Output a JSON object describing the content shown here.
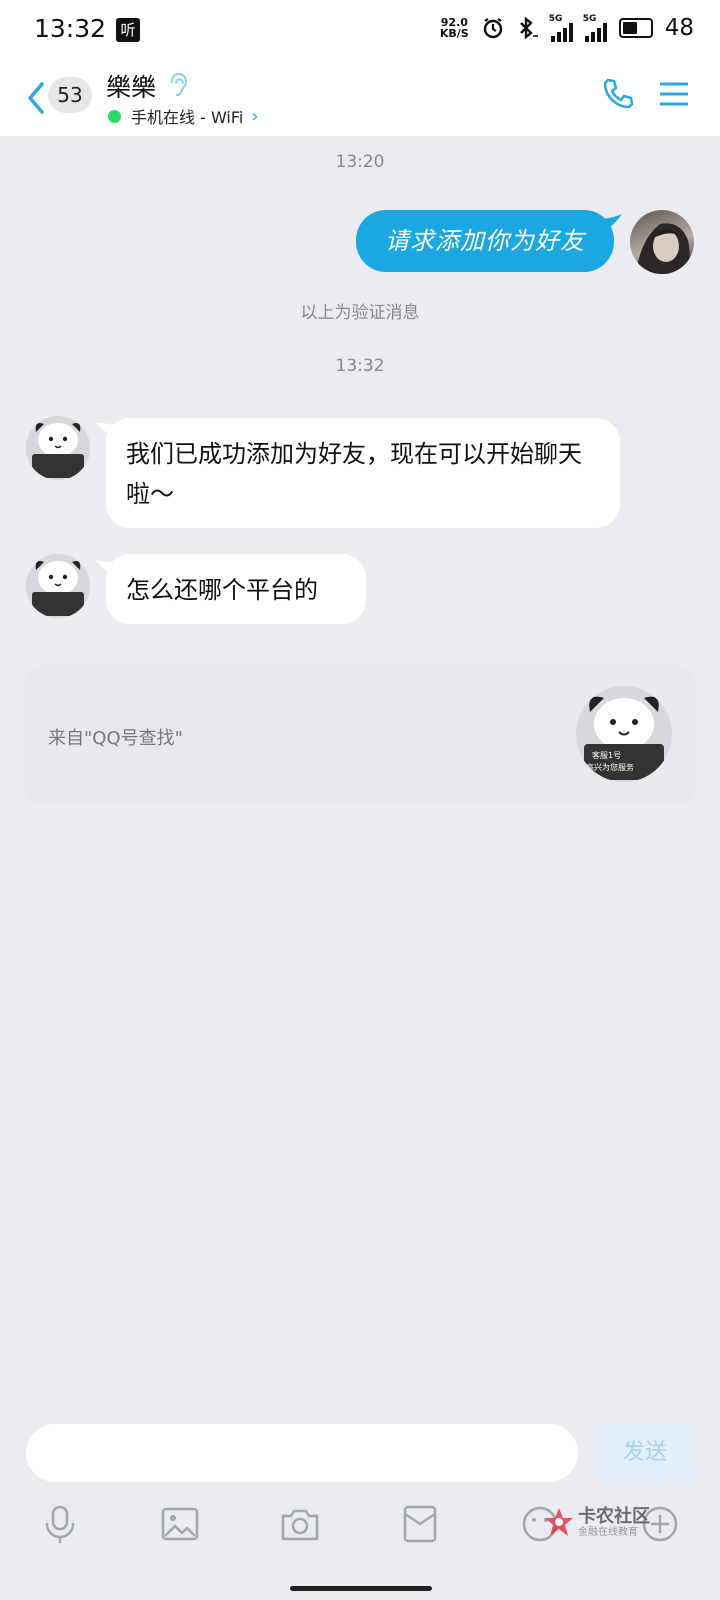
{
  "status_bar": {
    "time": "13:32",
    "app_badge": "听",
    "net_speed_value": "92.0",
    "net_speed_unit": "KB/S",
    "signal_1_label": "5G",
    "signal_2_label": "5G",
    "battery": "48"
  },
  "header": {
    "unread_count": "53",
    "contact_name": "樂樂",
    "presence": "手机在线 - WiFi"
  },
  "chat": {
    "timestamp_1": "13:20",
    "outgoing_message": "请求添加你为好友",
    "verification_note": "以上为验证消息",
    "timestamp_2": "13:32",
    "incoming_message_1": "我们已成功添加为好友，现在可以开始聊天啦～",
    "incoming_message_2": "怎么还哪个平台的",
    "bot_avatar_line1": "客服1号",
    "bot_avatar_line2": "高兴为您服务",
    "source_card_text": "来自\"QQ号查找\""
  },
  "composer": {
    "input_value": "",
    "send_label": "发送"
  },
  "toolbar": {
    "icons": [
      "microphone-icon",
      "image-icon",
      "camera-icon",
      "red-packet-icon",
      "emoji-icon",
      "plus-icon"
    ]
  },
  "watermark": {
    "main": "卡农社区",
    "sub": "金融在线教育"
  },
  "colors": {
    "accent": "#1ba7e2",
    "background": "#ebecf1",
    "online": "#2bd86a"
  }
}
